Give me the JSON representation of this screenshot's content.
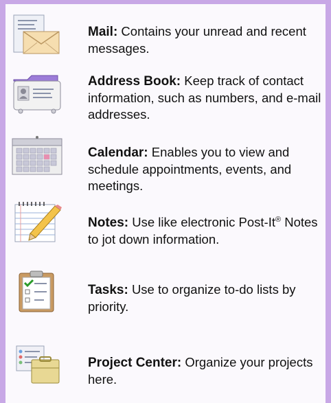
{
  "items": [
    {
      "icon": "mail-icon",
      "title": "Mail:",
      "desc": "Contains your unread and recent messages."
    },
    {
      "icon": "address-book-icon",
      "title": "Address Book:",
      "desc": "Keep track of contact information, such as numbers, and e-mail addresses."
    },
    {
      "icon": "calendar-icon",
      "title": "Calendar:",
      "desc": "Enables you to view and schedule appointments, events, and meetings."
    },
    {
      "icon": "notes-icon",
      "title": "Notes:",
      "desc_before": "Use like electronic Post-It",
      "desc_sup": "®",
      "desc_after": " Notes to jot down information."
    },
    {
      "icon": "tasks-icon",
      "title": "Tasks:",
      "desc": "Use to organize to-do lists by priority."
    },
    {
      "icon": "project-center-icon",
      "title": "Project Center:",
      "desc": "Organize your projects here."
    }
  ],
  "colors": {
    "frame": "#c8a8e6",
    "background": "#fbf9fd"
  }
}
